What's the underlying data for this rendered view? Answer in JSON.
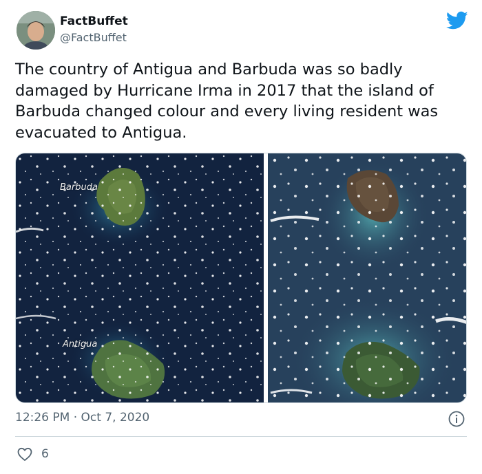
{
  "author": {
    "display_name": "FactBuffet",
    "handle": "@FactBuffet"
  },
  "tweet": {
    "text": "The country of Antigua and Barbuda was so badly damaged by Hurricane Irma in 2017 that the island of Barbuda changed colour and every living resident was evacuated to Antigua.",
    "timestamp": "12:26 PM · Oct 7, 2020",
    "likes": "6"
  },
  "media": {
    "label_top": "Barbuda",
    "label_bottom": "Antigua"
  },
  "icons": {
    "brand": "twitter-bird-icon",
    "info": "info-icon",
    "like": "heart-icon"
  },
  "colors": {
    "brand_blue": "#1d9bf0",
    "text_secondary": "#536471"
  }
}
